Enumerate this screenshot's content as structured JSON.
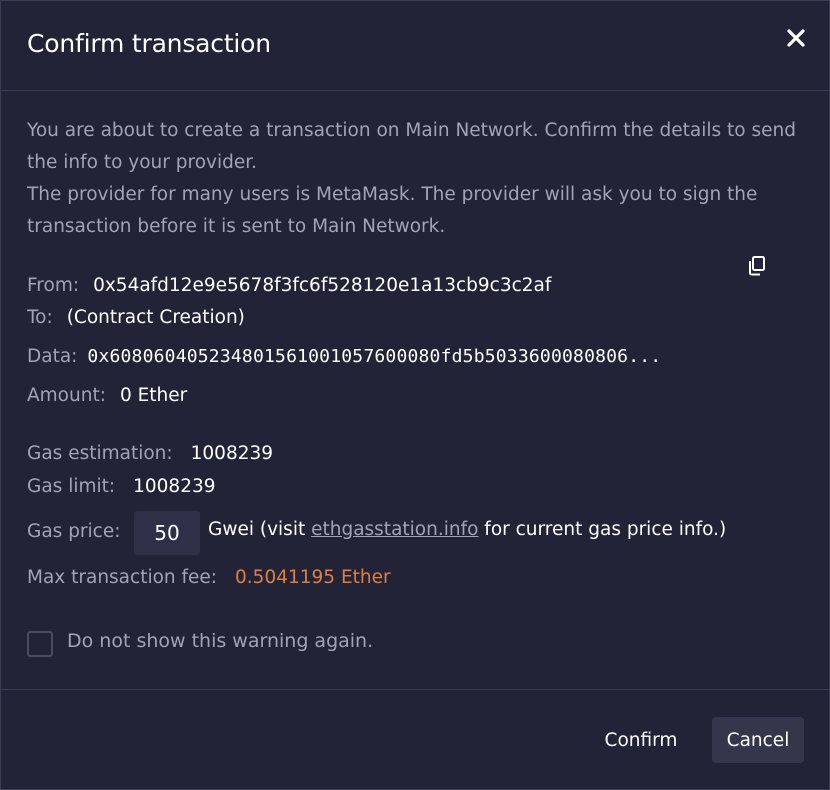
{
  "modal": {
    "title": "Confirm transaction",
    "intro_line1": "You are about to create a transaction on Main Network. Confirm the details to send the info to your provider.",
    "intro_line2": "The provider for many users is MetaMask. The provider will ask you to sign the transaction before it is sent to Main Network."
  },
  "details": {
    "from_label": "From:",
    "from_value": "0x54afd12e9e5678f3fc6f528120e1a13cb9c3c2af",
    "to_label": "To:",
    "to_value": "(Contract Creation)",
    "data_label": "Data:",
    "data_value": "0x608060405234801561001057600080fd5b5033600080806...",
    "amount_label": "Amount:",
    "amount_value": "0 Ether"
  },
  "gas": {
    "estimation_label": "Gas estimation:",
    "estimation_value": "1008239",
    "limit_label": "Gas limit:",
    "limit_value": "1008239",
    "price_label": "Gas price:",
    "price_value": "50",
    "unit_prefix": "Gwei (visit ",
    "link_text": "ethgasstation.info",
    "unit_suffix": " for current gas price info.)",
    "max_fee_label": "Max transaction fee:",
    "max_fee_value": "0.5041195 Ether"
  },
  "warning": {
    "checkbox_label": "Do not show this warning again."
  },
  "footer": {
    "confirm_label": "Confirm",
    "cancel_label": "Cancel"
  },
  "colors": {
    "background": "#222336",
    "muted_text": "#a2a3b7",
    "fee_accent": "#dd7f42",
    "button_secondary": "#35364c"
  },
  "icons": {
    "close": "close-icon",
    "copy": "copy-icon"
  }
}
